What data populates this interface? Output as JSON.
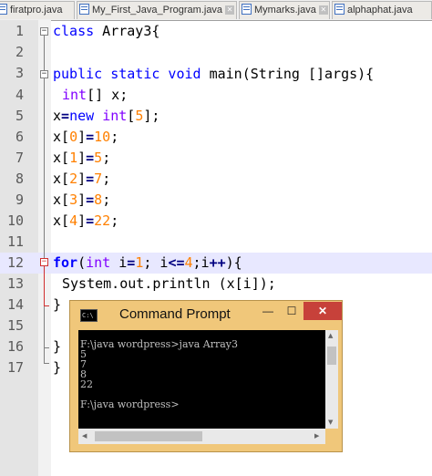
{
  "tabs": [
    {
      "label": "firatpro.java"
    },
    {
      "label": "My_First_Java_Program.java"
    },
    {
      "label": "Mymarks.java"
    },
    {
      "label": "alphaphat.java"
    }
  ],
  "editor": {
    "line_numbers": [
      "1",
      "2",
      "3",
      "4",
      "5",
      "6",
      "7",
      "8",
      "9",
      "10",
      "11",
      "12",
      "13",
      "14",
      "15",
      "16",
      "17"
    ],
    "lines": {
      "l1": {
        "kw": "class",
        "rest": " Array3{"
      },
      "l3": {
        "kw": "public static void",
        "rest": " main(String []args){"
      },
      "l4": {
        "type": "int",
        "rest": "[] x;"
      },
      "l5": {
        "a": "x",
        "eq": "=",
        "new": "new",
        "sp": " ",
        "type": "int",
        "b": "[",
        "n": "5",
        "c": "];"
      },
      "l6": {
        "a": "x[",
        "i": "0",
        "b": "]",
        "eq": "=",
        "v": "10",
        "c": ";"
      },
      "l7": {
        "a": "x[",
        "i": "1",
        "b": "]",
        "eq": "=",
        "v": "5",
        "c": ";"
      },
      "l8": {
        "a": "x[",
        "i": "2",
        "b": "]",
        "eq": "=",
        "v": "7",
        "c": ";"
      },
      "l9": {
        "a": "x[",
        "i": "3",
        "b": "]",
        "eq": "=",
        "v": "8",
        "c": ";"
      },
      "l10": {
        "a": "x[",
        "i": "4",
        "b": "]",
        "eq": "=",
        "v": "22",
        "c": ";"
      },
      "l12": {
        "kw": "for",
        "p": "(",
        "type": "int",
        "i": " i",
        "eq": "=",
        "n1": "1",
        "s1": "; i",
        "le": "<=",
        "n2": "4",
        "s2": ";i",
        "inc": "++",
        "end": "){"
      },
      "l13": {
        "text": "System.out.println (x[i]);"
      },
      "l14": {
        "text": "}"
      },
      "l16": {
        "text": "}"
      },
      "l17": {
        "text": "}"
      }
    }
  },
  "cmd": {
    "title": "Command Prompt",
    "output": [
      "F:\\java wordpress>java Array3",
      "5",
      "7",
      "8",
      "22",
      "",
      "F:\\java wordpress>"
    ],
    "btn_min": "—",
    "btn_max": "☐",
    "btn_close": "✕"
  },
  "colors": {
    "keyword": "#0000ff",
    "type": "#8000ff",
    "number": "#ff8000",
    "operator": "#000080",
    "fold_active": "#d03030",
    "cmd_frame": "#f0c77a",
    "cmd_close": "#c7413a"
  }
}
